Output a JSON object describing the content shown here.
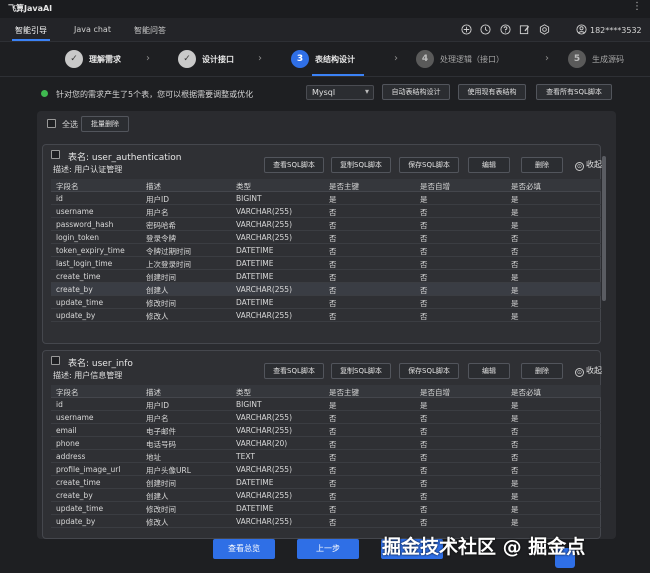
{
  "app": {
    "title": "飞算JavaAI",
    "menu_glyph": "⋮"
  },
  "nav": {
    "tabs": [
      "智能引导",
      "Java chat",
      "智能问答"
    ],
    "user": "182****3532"
  },
  "steps": [
    {
      "num": "✓",
      "label": "理解需求",
      "state": "done"
    },
    {
      "num": "✓",
      "label": "设计接口",
      "state": "done"
    },
    {
      "num": "3",
      "label": "表结构设计",
      "state": "active"
    },
    {
      "num": "4",
      "label": "处理逻辑（接口）",
      "state": "todo"
    },
    {
      "num": "5",
      "label": "生成源码",
      "state": "todo"
    }
  ],
  "info": {
    "message": "针对您的需求产生了5个表，您可以根据需要调整或优化",
    "db_type": "Mysql",
    "db_caret": "▾",
    "buttons": [
      "自动表结构设计",
      "使用现有表结构",
      "查看所有SQL脚本"
    ]
  },
  "toolbar": {
    "select_all": "全选",
    "bulk_delete": "批量删除"
  },
  "card_buttons": [
    "查看SQL脚本",
    "复制SQL脚本",
    "保存SQL脚本",
    "编辑",
    "删除"
  ],
  "collapse_label": "收起",
  "collapse_glyph": "⊙",
  "columns": [
    "字段名",
    "描述",
    "类型",
    "是否主键",
    "是否自增",
    "是否必填"
  ],
  "tables": [
    {
      "name": "表名: user_authentication",
      "desc": "描述: 用户认证管理",
      "rows": [
        [
          "id",
          "用户ID",
          "BIGINT",
          "是",
          "是",
          "是"
        ],
        [
          "username",
          "用户名",
          "VARCHAR(255)",
          "否",
          "否",
          "是"
        ],
        [
          "password_hash",
          "密码哈希",
          "VARCHAR(255)",
          "否",
          "否",
          "是"
        ],
        [
          "login_token",
          "登录令牌",
          "VARCHAR(255)",
          "否",
          "否",
          "否"
        ],
        [
          "token_expiry_time",
          "令牌过期时间",
          "DATETIME",
          "否",
          "否",
          "否"
        ],
        [
          "last_login_time",
          "上次登录时间",
          "DATETIME",
          "否",
          "否",
          "否"
        ],
        [
          "create_time",
          "创建时间",
          "DATETIME",
          "否",
          "否",
          "是"
        ],
        [
          "create_by",
          "创建人",
          "VARCHAR(255)",
          "否",
          "否",
          "是"
        ],
        [
          "update_time",
          "修改时间",
          "DATETIME",
          "否",
          "否",
          "是"
        ],
        [
          "update_by",
          "修改人",
          "VARCHAR(255)",
          "否",
          "否",
          "是"
        ]
      ]
    },
    {
      "name": "表名: user_info",
      "desc": "描述: 用户信息管理",
      "rows": [
        [
          "id",
          "用户ID",
          "BIGINT",
          "是",
          "是",
          "是"
        ],
        [
          "username",
          "用户名",
          "VARCHAR(255)",
          "否",
          "否",
          "是"
        ],
        [
          "email",
          "电子邮件",
          "VARCHAR(255)",
          "否",
          "否",
          "否"
        ],
        [
          "phone",
          "电话号码",
          "VARCHAR(20)",
          "否",
          "否",
          "否"
        ],
        [
          "address",
          "地址",
          "TEXT",
          "否",
          "否",
          "否"
        ],
        [
          "profile_image_url",
          "用户头像URL",
          "VARCHAR(255)",
          "否",
          "否",
          "否"
        ],
        [
          "create_time",
          "创建时间",
          "DATETIME",
          "否",
          "否",
          "是"
        ],
        [
          "create_by",
          "创建人",
          "VARCHAR(255)",
          "否",
          "否",
          "是"
        ],
        [
          "update_time",
          "修改时间",
          "DATETIME",
          "否",
          "否",
          "是"
        ],
        [
          "update_by",
          "修改人",
          "VARCHAR(255)",
          "否",
          "否",
          "是"
        ]
      ]
    }
  ],
  "bottom": {
    "overview": "查看总览",
    "prev": "上一步"
  },
  "watermark": "掘金技术社区 @ 掘金点"
}
